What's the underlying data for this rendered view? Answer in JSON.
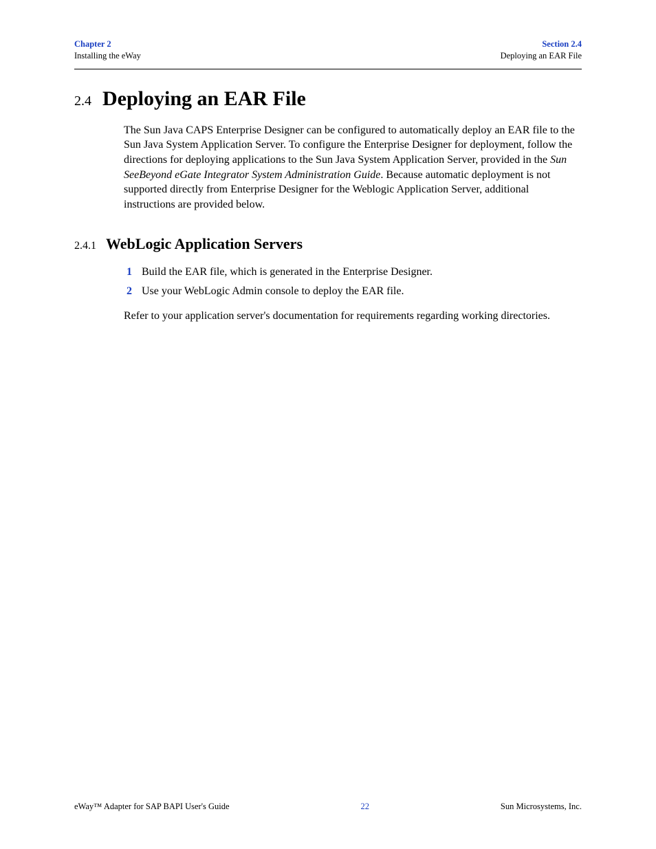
{
  "header": {
    "left_top": "Chapter 2",
    "left_sub": "Installing the eWay",
    "right_top": "Section 2.4",
    "right_sub": "Deploying an EAR File"
  },
  "section": {
    "num": "2.4",
    "title": "Deploying an EAR File",
    "para_a": "The Sun Java CAPS Enterprise Designer can be configured to automatically deploy an EAR file to the Sun Java System Application Server. To configure the Enterprise Designer for deployment, follow the directions for deploying applications to the Sun Java System Application Server, provided in the ",
    "para_italic": "Sun SeeBeyond eGate Integrator System Administration Guide",
    "para_b": ". Because automatic deployment is not supported directly from Enterprise Designer for the Weblogic Application Server, additional instructions are provided below."
  },
  "subsection": {
    "num": "2.4.1",
    "title": "WebLogic Application Servers",
    "items": [
      {
        "n": "1",
        "t": "Build the EAR file, which is generated in the Enterprise Designer."
      },
      {
        "n": "2",
        "t": "Use your WebLogic Admin console to deploy the EAR file."
      }
    ],
    "after": "Refer to your application server's documentation for requirements regarding working directories."
  },
  "footer": {
    "left": "eWay™ Adapter for SAP BAPI User's Guide",
    "page": "22",
    "right": "Sun Microsystems, Inc."
  }
}
